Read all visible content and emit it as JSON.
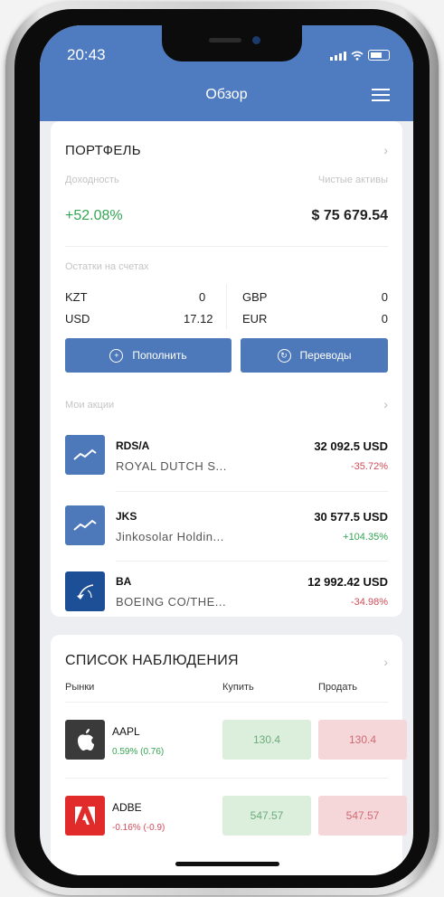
{
  "status_bar": {
    "time": "20:43"
  },
  "header": {
    "title": "Обзор"
  },
  "portfolio": {
    "title": "ПОРТФЕЛЬ",
    "return_label": "Доходность",
    "net_assets_label": "Чистые активы",
    "return_value": "+52.08%",
    "net_assets_value": "$ 75 679.54",
    "balances_label": "Остатки на счетах",
    "balances": [
      {
        "currency": "KZT",
        "amount": "0"
      },
      {
        "currency": "USD",
        "amount": "17.12"
      },
      {
        "currency": "GBP",
        "amount": "0"
      },
      {
        "currency": "EUR",
        "amount": "0"
      }
    ],
    "deposit_label": "Пополнить",
    "transfers_label": "Переводы",
    "my_stocks_label": "Мои акции",
    "stocks": [
      {
        "ticker": "RDS/A",
        "name": "ROYAL DUTCH S...",
        "amount": "32 092.5 USD",
        "change": "-35.72%",
        "icon": "chart-trend-icon"
      },
      {
        "ticker": "JKS",
        "name": "Jinkosolar Holdin...",
        "amount": "30 577.5 USD",
        "change": "+104.35%",
        "icon": "chart-trend-icon"
      },
      {
        "ticker": "BA",
        "name": "BOEING CO/THE...",
        "amount": "12 992.42 USD",
        "change": "-34.98%",
        "icon": "boeing-logo-icon"
      }
    ]
  },
  "watchlist": {
    "title": "СПИСОК НАБЛЮДЕНИЯ",
    "col_markets": "Рынки",
    "col_buy": "Купить",
    "col_sell": "Продать",
    "items": [
      {
        "ticker": "AAPL",
        "change": "0.59% (0.76)",
        "buy": "130.4",
        "sell": "130.4",
        "icon": "apple-logo-icon"
      },
      {
        "ticker": "ADBE",
        "change": "-0.16% (-0.9)",
        "buy": "547.57",
        "sell": "547.57",
        "icon": "adobe-logo-icon"
      }
    ]
  },
  "colors": {
    "header": "#4f7cc1",
    "button": "#4d78b9",
    "positive": "#35a553",
    "negative": "#d24b5a"
  }
}
